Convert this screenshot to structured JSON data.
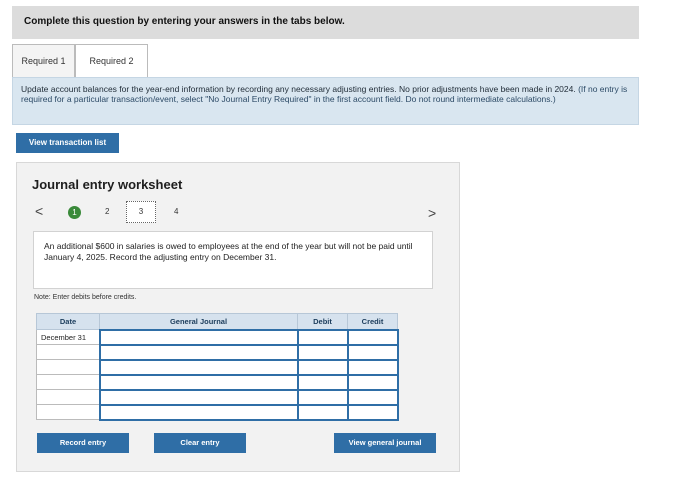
{
  "header": {
    "title": "Complete this question by entering your answers in the tabs below."
  },
  "tabs": [
    {
      "label": "Required 1"
    },
    {
      "label": "Required 2"
    }
  ],
  "instructions": {
    "text": "Update account balances for the year-end information by recording any necessary adjusting entries. No prior adjustments have been made in 2024. ",
    "note": "(If no entry is required for a particular transaction/event, select \"No Journal Entry Required\" in the first account field. Do not round intermediate calculations.)"
  },
  "view_transaction_list": "View transaction list",
  "worksheet": {
    "title": "Journal entry worksheet",
    "nav_prev": "<",
    "nav_next": ">",
    "steps": [
      "1",
      "2",
      "3",
      "4"
    ],
    "description": "An additional $600 in salaries is owed to employees at the end of the year but will not be paid until January 4, 2025. Record the adjusting entry on December 31.",
    "note": "Note: Enter debits before credits.",
    "table": {
      "headers": {
        "date": "Date",
        "general_journal": "General Journal",
        "debit": "Debit",
        "credit": "Credit"
      },
      "rows": [
        {
          "date": "December 31"
        },
        {
          "date": ""
        },
        {
          "date": ""
        },
        {
          "date": ""
        },
        {
          "date": ""
        },
        {
          "date": ""
        }
      ]
    },
    "buttons": {
      "record": "Record entry",
      "clear": "Clear entry",
      "view_journal": "View general journal"
    }
  },
  "colors": {
    "accent": "#2f6ea6",
    "instruction_bg": "#d9e6f0",
    "step_done": "#3a8a3a"
  }
}
